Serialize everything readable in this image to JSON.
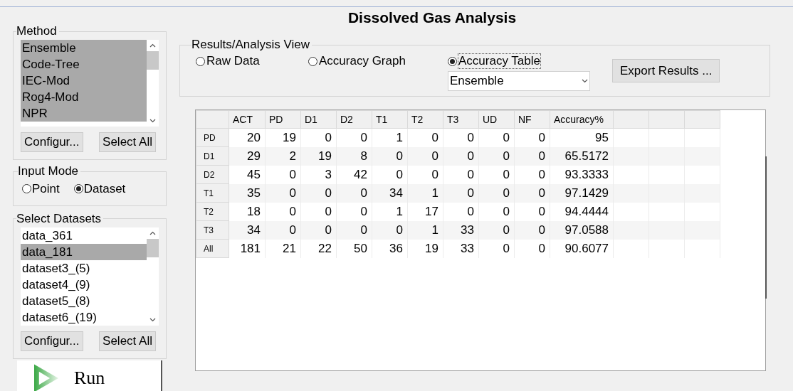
{
  "window": {
    "title": "Dissolved Gas Analysis"
  },
  "method": {
    "label": "Method",
    "items": [
      {
        "label": "Ensemble",
        "selected": true
      },
      {
        "label": "Code-Tree",
        "selected": true
      },
      {
        "label": "IEC-Mod",
        "selected": true
      },
      {
        "label": "Rog4-Mod",
        "selected": true
      },
      {
        "label": "NPR",
        "selected": true
      }
    ],
    "buttons": [
      "Configur...",
      "Select All"
    ]
  },
  "input_mode": {
    "label": "Input Mode",
    "options": [
      {
        "label": "Point",
        "selected": false
      },
      {
        "label": "Dataset",
        "selected": true
      }
    ]
  },
  "datasets": {
    "label": "Select Datasets",
    "items": [
      {
        "label": "data_361",
        "selected": false
      },
      {
        "label": "data_181",
        "selected": true
      },
      {
        "label": "dataset3_(5)",
        "selected": false
      },
      {
        "label": "dataset4_(9)",
        "selected": false
      },
      {
        "label": "dataset5_(8)",
        "selected": false
      },
      {
        "label": "dataset6_(19)",
        "selected": false
      }
    ],
    "buttons": [
      "Configur...",
      "Select All"
    ]
  },
  "run_button": {
    "label": "Run"
  },
  "results_view": {
    "label": "Results/Analysis View",
    "options": [
      {
        "label": "Raw Data",
        "selected": false
      },
      {
        "label": "Accuracy Graph",
        "selected": false
      },
      {
        "label": "Accuracy Table",
        "selected": true
      }
    ],
    "dropdown": "Ensemble",
    "export_button": "Export Results ..."
  },
  "table": {
    "columns": [
      "ACT",
      "PD",
      "D1",
      "D2",
      "T1",
      "T2",
      "T3",
      "UD",
      "NF",
      "Accuracy%"
    ],
    "rows": [
      {
        "header": "PD",
        "cells": [
          "20",
          "19",
          "0",
          "0",
          "1",
          "0",
          "0",
          "0",
          "0",
          "95"
        ]
      },
      {
        "header": "D1",
        "cells": [
          "29",
          "2",
          "19",
          "8",
          "0",
          "0",
          "0",
          "0",
          "0",
          "65.5172"
        ]
      },
      {
        "header": "D2",
        "cells": [
          "45",
          "0",
          "3",
          "42",
          "0",
          "0",
          "0",
          "0",
          "0",
          "93.3333"
        ]
      },
      {
        "header": "T1",
        "cells": [
          "35",
          "0",
          "0",
          "0",
          "34",
          "1",
          "0",
          "0",
          "0",
          "97.1429"
        ]
      },
      {
        "header": "T2",
        "cells": [
          "18",
          "0",
          "0",
          "0",
          "1",
          "17",
          "0",
          "0",
          "0",
          "94.4444"
        ]
      },
      {
        "header": "T3",
        "cells": [
          "34",
          "0",
          "0",
          "0",
          "0",
          "1",
          "33",
          "0",
          "0",
          "97.0588"
        ]
      },
      {
        "header": "All",
        "cells": [
          "181",
          "21",
          "22",
          "50",
          "36",
          "19",
          "33",
          "0",
          "0",
          "90.6077"
        ]
      }
    ]
  }
}
